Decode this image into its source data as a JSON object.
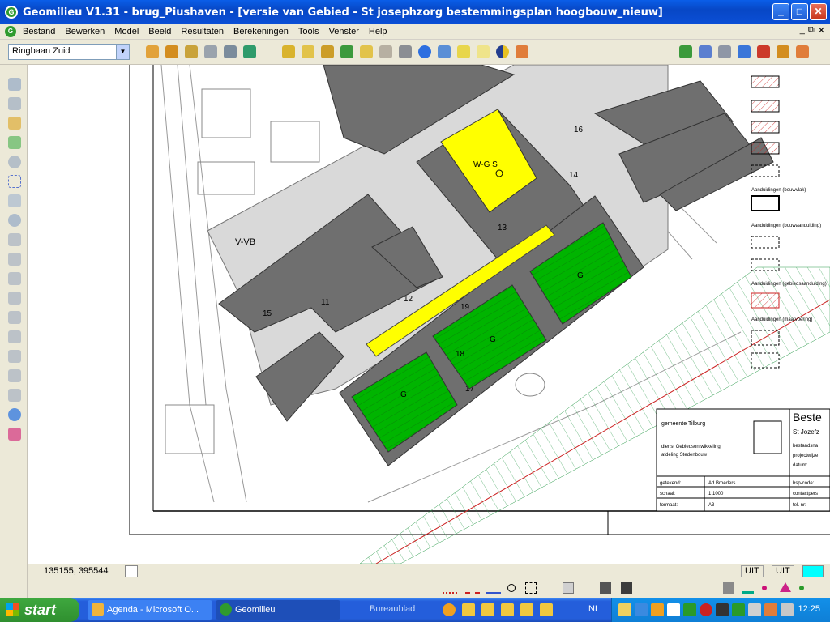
{
  "window": {
    "title": "Geomilieu V1.31 - brug_Piushaven - [versie van Gebied - St josephzorg bestemmingsplan hoogbouw_nieuw]",
    "app_icon": "G"
  },
  "menu": [
    "Bestand",
    "Bewerken",
    "Model",
    "Beeld",
    "Resultaten",
    "Berekeningen",
    "Tools",
    "Venster",
    "Help"
  ],
  "toolbar": {
    "combo_value": "Ringbaan Zuid"
  },
  "map": {
    "plan_labels": {
      "vvb": "V-VB",
      "wgs": "W-G S",
      "g": "G"
    },
    "points": [
      "11",
      "12",
      "13",
      "14",
      "15",
      "16",
      "17",
      "18",
      "19"
    ],
    "legend_items": [
      "Aanduidingen (bouwvlak)",
      "Aanduidingen (bouwaanduiding)",
      "Aanduidingen (gebiedsaanduiding)",
      "Aanduidingen (maatvoering)"
    ],
    "cartouche": {
      "gemeente": "gemeente Tilburg",
      "dienst": "dienst Gebiedsontwikkeling",
      "afdeling": "afdeling Stedenbouw",
      "title_partial": "Beste",
      "subtitle_partial": "St Jozefz",
      "rows_right": [
        "bestandsna",
        "projectwijze",
        "datum:"
      ],
      "getekend_label": "getekend:",
      "getekend_value": "Ad Broeders",
      "schaal_label": "schaal:",
      "schaal_value": "1:1000",
      "formaat_label": "formaat:",
      "formaat_value": "A3",
      "bsp_label": "bsp-code:",
      "contact_label": "contactpers",
      "tel_label": "tel. nr:"
    }
  },
  "status": {
    "coords": "135155, 395544",
    "uit1": "UIT",
    "uit2": "UIT"
  },
  "taskbar": {
    "start": "start",
    "tasks": [
      "Agenda - Microsoft O...",
      "Geomilieu"
    ],
    "desk_label": "Bureaublad",
    "lang": "NL",
    "clock": "12:25"
  }
}
